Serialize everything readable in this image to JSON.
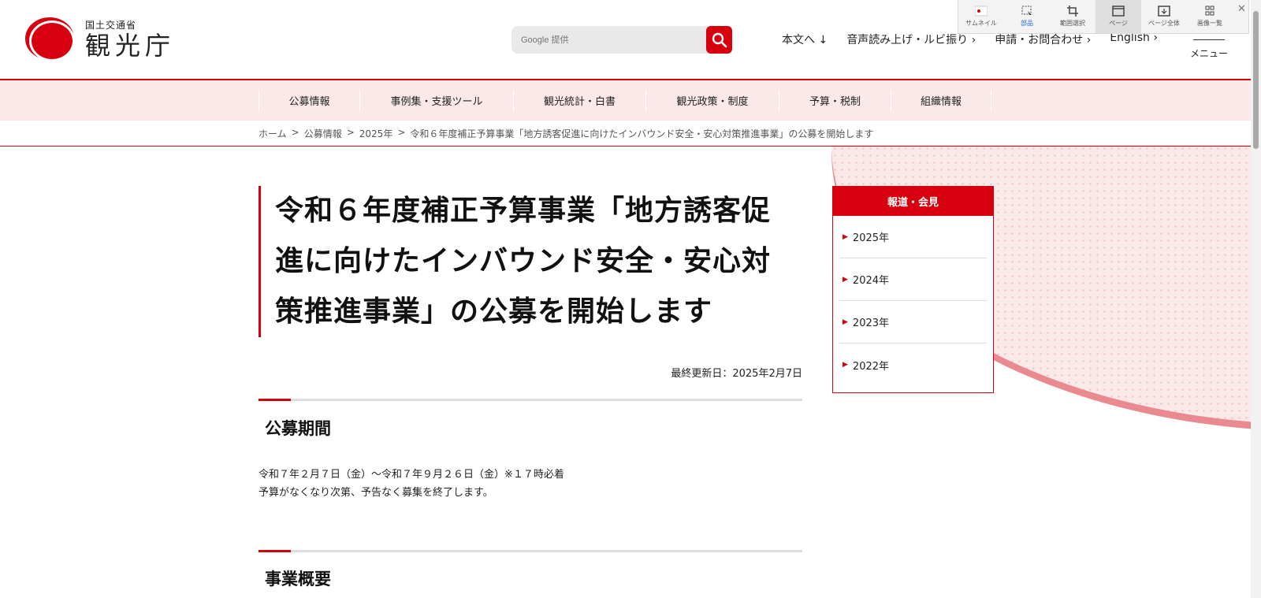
{
  "header": {
    "logo_sub": "国土交通省",
    "logo_main": "観光庁",
    "search_placeholder": "Google 提供",
    "util_links": [
      "本文へ ↓",
      "音声読み上げ・ルビ振り ›",
      "申請・お問合わせ ›",
      "English ›"
    ],
    "menu_label": "メニュー"
  },
  "capture_toolbar": {
    "items": [
      "サムネイル",
      "部品",
      "範囲選択",
      "ページ",
      "ページ全体",
      "画像一覧"
    ]
  },
  "nav": {
    "items": [
      "公募情報",
      "事例集・支援ツール",
      "観光統計・白書",
      "観光政策・制度",
      "予算・税制",
      "組織情報"
    ]
  },
  "breadcrumb": [
    "ホーム",
    "公募情報",
    "2025年",
    "令和６年度補正予算事業「地方誘客促進に向けたインバウンド安全・安心対策推進事業」の公募を開始します"
  ],
  "breadcrumb_sep": ">",
  "main": {
    "title_lines": [
      "令和６年度補正予算事業「地方誘客促",
      "進に向けたインバウンド安全・安心対",
      "策推進事業」の公募を開始します"
    ],
    "updated": "最終更新日：2025年2月7日",
    "section1_title": "公募期間",
    "section1_lines": [
      "令和７年２月７日（金）～令和７年９月２６日（金）※１７時必着",
      "予算がなくなり次第、予告なく募集を終了します。"
    ],
    "section2_title": "事業概要"
  },
  "sidebar": {
    "heading": "報道・会見",
    "items": [
      "2025年",
      "2024年",
      "2023年",
      "2022年"
    ]
  },
  "colors": {
    "accent": "#d7000f",
    "nav_bg": "#fbe9ea"
  }
}
